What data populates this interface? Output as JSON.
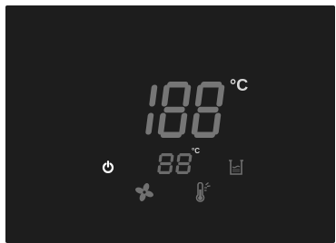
{
  "display": {
    "main_digits": "188",
    "main_unit": "°C",
    "sub_digits": "88",
    "sub_unit": "°C"
  },
  "icons": {
    "power": "power-icon",
    "fan": "fan-icon",
    "thermometer": "thermometer-icon",
    "water_level": "water-level-icon"
  },
  "colors": {
    "panel": "#1d1d1d",
    "segment_main": "#767676",
    "segment_sub": "#6b6b6b",
    "icon_dim": "#6f6f6f",
    "icon_active": "#ffffff",
    "unit_text": "#d8d8d8"
  }
}
